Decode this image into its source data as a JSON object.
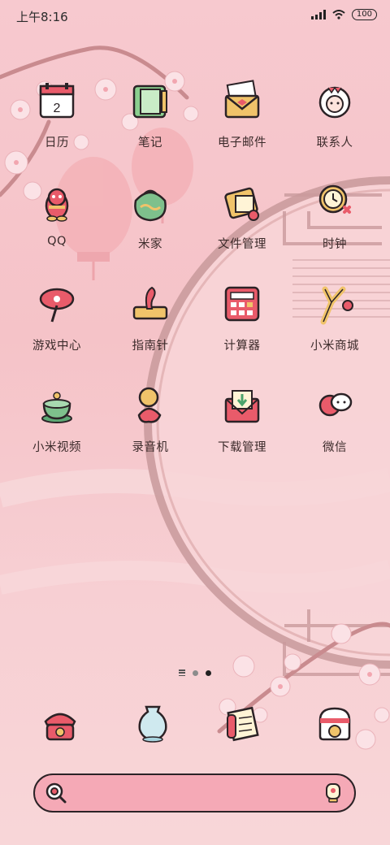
{
  "status_bar": {
    "time": "上午8:16",
    "battery": "100"
  },
  "apps": [
    {
      "label": "日历",
      "icon": "calendar-icon"
    },
    {
      "label": "笔记",
      "icon": "notes-icon"
    },
    {
      "label": "电子邮件",
      "icon": "email-icon"
    },
    {
      "label": "联系人",
      "icon": "contacts-icon"
    },
    {
      "label": "QQ",
      "icon": "qq-icon"
    },
    {
      "label": "米家",
      "icon": "mijia-icon"
    },
    {
      "label": "文件管理",
      "icon": "file-manager-icon"
    },
    {
      "label": "时钟",
      "icon": "clock-icon"
    },
    {
      "label": "游戏中心",
      "icon": "game-center-icon"
    },
    {
      "label": "指南针",
      "icon": "compass-icon"
    },
    {
      "label": "计算器",
      "icon": "calculator-icon"
    },
    {
      "label": "小米商城",
      "icon": "mi-store-icon"
    },
    {
      "label": "小米视频",
      "icon": "mi-video-icon"
    },
    {
      "label": "录音机",
      "icon": "recorder-icon"
    },
    {
      "label": "下载管理",
      "icon": "download-manager-icon"
    },
    {
      "label": "微信",
      "icon": "wechat-icon"
    }
  ],
  "calendar_day": "2",
  "dock": [
    {
      "icon": "phone-icon"
    },
    {
      "icon": "messages-icon"
    },
    {
      "icon": "browser-icon"
    },
    {
      "icon": "camera-icon"
    }
  ],
  "colors": {
    "accent": "#e95b6a",
    "outline": "#2b2226",
    "background": "#f6c6cb"
  }
}
